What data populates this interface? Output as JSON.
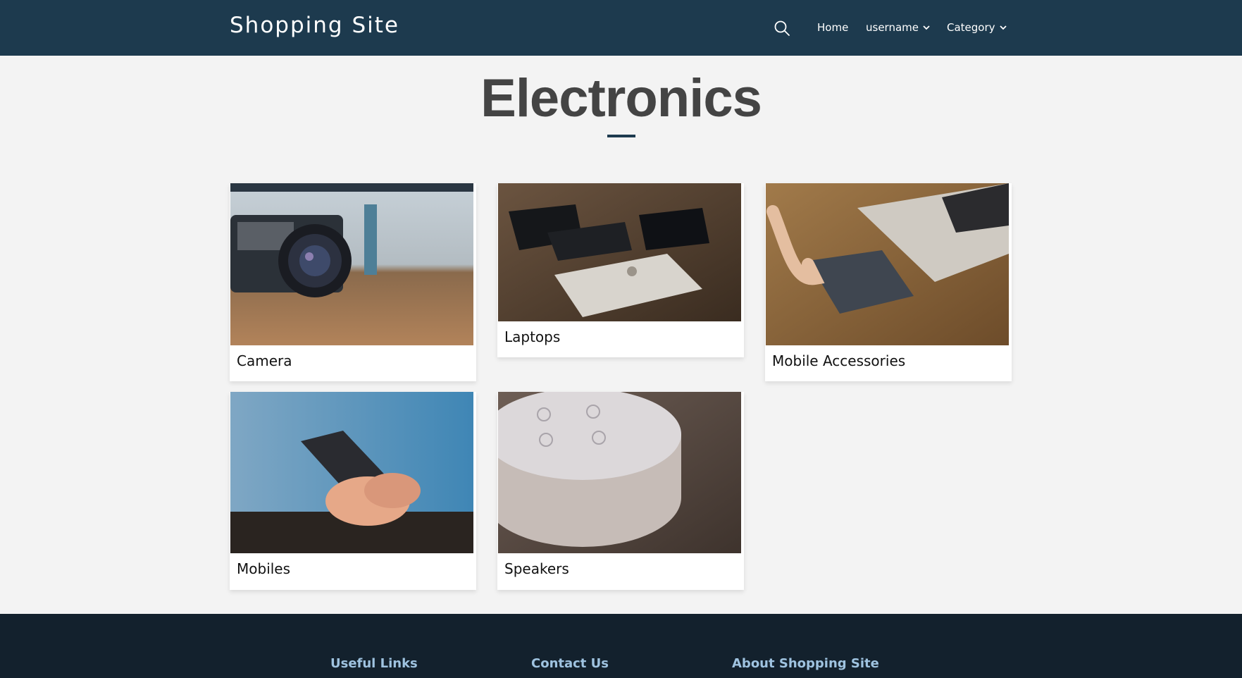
{
  "header": {
    "brand": "Shopping Site",
    "nav": {
      "home": "Home",
      "user": "username",
      "category": "Category"
    }
  },
  "main": {
    "title": "Electronics",
    "categories": [
      {
        "label": "Camera"
      },
      {
        "label": "Laptops"
      },
      {
        "label": "Mobile Accessories"
      },
      {
        "label": "Mobiles"
      },
      {
        "label": "Speakers"
      }
    ]
  },
  "footer": {
    "headings": [
      "Useful Links",
      "Contact Us",
      "About Shopping Site"
    ]
  },
  "colors": {
    "navbar": "#1d3a4e",
    "footer": "#13212d",
    "footer_heading": "#9fc3e0",
    "page_background": "#f3f3f3"
  }
}
